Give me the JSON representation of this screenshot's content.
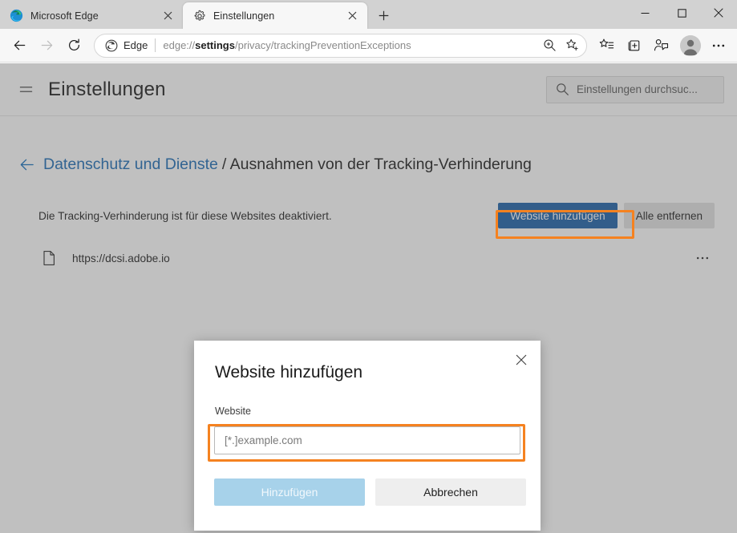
{
  "window": {
    "controls": {
      "minimize_label": "Minimieren",
      "maximize_label": "Maximieren",
      "close_label": "Schließen"
    }
  },
  "tabs": [
    {
      "title": "Microsoft Edge",
      "favicon": "edge-logo-icon",
      "active": false
    },
    {
      "title": "Einstellungen",
      "favicon": "gear-icon",
      "active": true
    }
  ],
  "newtab_label": "+",
  "toolbar": {
    "back_label": "Zurück",
    "forward_label": "Vorwärts",
    "refresh_label": "Aktualisieren",
    "omnibox": {
      "brand": "Edge",
      "url_prefix": "edge://",
      "url_bold": "settings",
      "url_suffix": "/privacy/trackingPreventionExceptions",
      "zoom_label": "Zoomen",
      "favorite_label": "Zu Favoriten hinzufügen"
    },
    "icons": [
      "favorites-icon",
      "collections-icon",
      "share-feedback-icon"
    ],
    "avatar_label": "Profil",
    "more_label": "Einstellungen und mehr"
  },
  "settings": {
    "menu_label": "Menü",
    "title": "Einstellungen",
    "search": {
      "placeholder": "Einstellungen durchsuc...",
      "icon": "search-icon"
    },
    "breadcrumb": {
      "back_label": "Zurück",
      "link": "Datenschutz und Dienste",
      "separator": "/",
      "current": "Ausnahmen von der Tracking-Verhinderung"
    },
    "description": "Die Tracking-Verhinderung ist für diese Websites deaktiviert.",
    "add_site_button": "Website hinzufügen",
    "remove_all_button": "Alle entfernen",
    "sites": [
      {
        "url": "https://dcsi.adobe.io",
        "icon": "page-icon",
        "more_label": "..."
      }
    ]
  },
  "dialog": {
    "title": "Website hinzufügen",
    "close_label": "Schließen",
    "field_label": "Website",
    "field_value": "",
    "field_placeholder": "[*.]example.com",
    "submit_button": "Hinzufügen",
    "cancel_button": "Abbrechen"
  },
  "annotations": {
    "highlight_color": "#f58220",
    "targets": [
      "add-site-button",
      "website-input"
    ]
  },
  "colors": {
    "primary_blue": "#1a5fa8",
    "link_blue": "#1a6bb5",
    "highlight_orange": "#f58220",
    "disabled_blue": "#a7d2ea",
    "tabstrip_gray": "#d2d2d2",
    "toolbar_gray": "#f7f7f7"
  }
}
